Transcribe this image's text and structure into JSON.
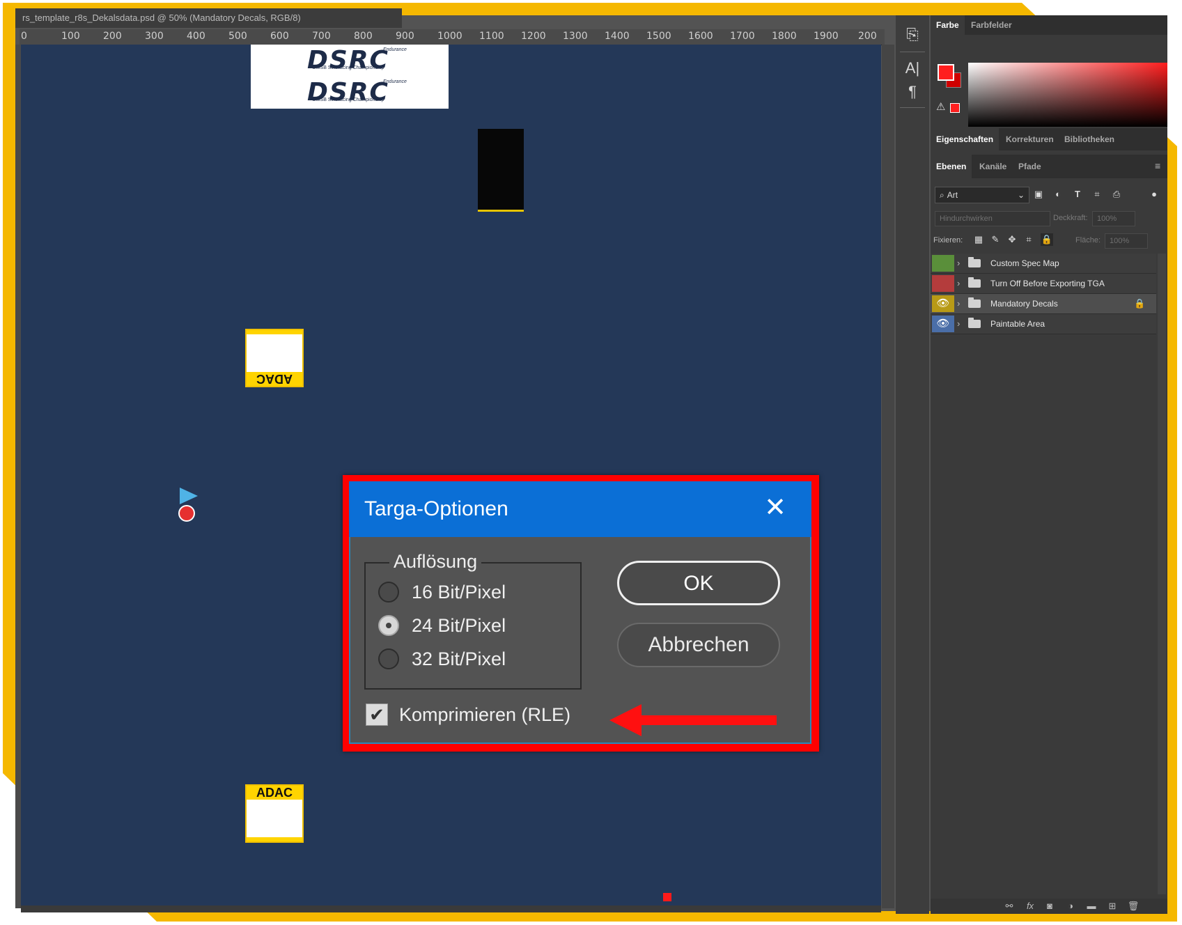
{
  "document": {
    "tab_title": "rs_template_r8s_Dekalsdata.psd @ 50% (Mandatory Decals, RGB/8)",
    "ruler_ticks": [
      "0",
      "100",
      "200",
      "300",
      "400",
      "500",
      "600",
      "700",
      "800",
      "900",
      "1000",
      "1100",
      "1200",
      "1300",
      "1400",
      "1500",
      "1600",
      "1700",
      "1800",
      "1900",
      "200"
    ]
  },
  "canvas": {
    "background": "#243858",
    "logo_text": "DSRC",
    "logo_endurance": "Endurance",
    "logo_subtitle": "DMSB SimRacing Championship",
    "adac_text": "ADAC"
  },
  "toolstrip": {
    "icons": [
      "history-panel-icon",
      "character-panel-icon",
      "paragraph-panel-icon"
    ]
  },
  "color_panel": {
    "tabs": [
      "Farbe",
      "Farbfelder"
    ],
    "active_tab": "Farbe",
    "foreground": "#ff1e1e",
    "background": "#d00000"
  },
  "properties_tabs": {
    "tabs": [
      "Eigenschaften",
      "Korrekturen",
      "Bibliotheken"
    ],
    "active_tab": "Eigenschaften"
  },
  "layers_panel": {
    "tabs": [
      "Ebenen",
      "Kanäle",
      "Pfade"
    ],
    "active_tab": "Ebenen",
    "filter_placeholder": "Art",
    "blend_mode": "Hindurchwirken",
    "opacity_label": "Deckkraft:",
    "opacity_value": "100%",
    "lock_label": "Fixieren:",
    "fill_label": "Fläche:",
    "fill_value": "100%",
    "layers": [
      {
        "name": "Custom Spec Map",
        "color": "#5a8f3a",
        "visible": false,
        "locked": false
      },
      {
        "name": "Turn Off Before Exporting TGA",
        "color": "#b43c3c",
        "visible": false,
        "locked": false
      },
      {
        "name": "Mandatory Decals",
        "color": "#b89a16",
        "visible": true,
        "locked": true
      },
      {
        "name": "Paintable Area",
        "color": "#4a6ea8",
        "visible": true,
        "locked": false
      }
    ]
  },
  "dialog": {
    "title": "Targa-Optionen",
    "group_label": "Auflösung",
    "options": [
      {
        "label": "16 Bit/Pixel",
        "checked": false
      },
      {
        "label": "24 Bit/Pixel",
        "checked": true
      },
      {
        "label": "32 Bit/Pixel",
        "checked": false
      }
    ],
    "compress_label": "Komprimieren (RLE)",
    "compress_checked": true,
    "ok_label": "OK",
    "cancel_label": "Abbrechen",
    "titlebar_color": "#0b6fd6",
    "highlight_color": "#ff0000"
  },
  "frame_color": "#f5b800"
}
